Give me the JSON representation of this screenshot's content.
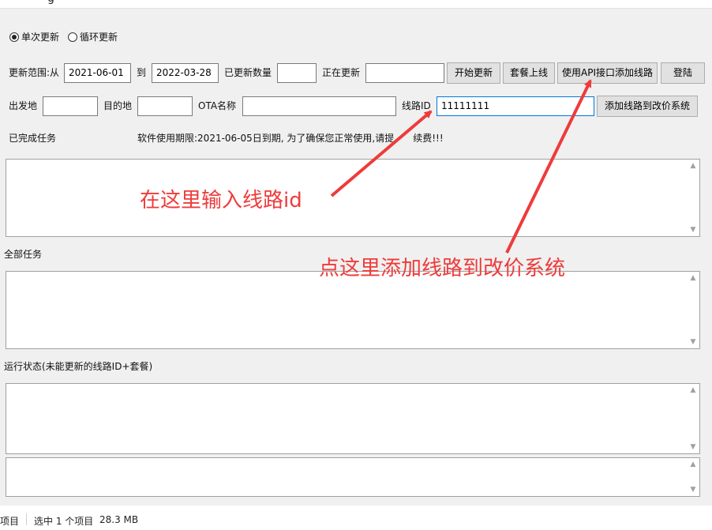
{
  "window": {
    "title_fragment": "g"
  },
  "update_mode": {
    "options": [
      {
        "label": "单次更新",
        "checked": true
      },
      {
        "label": "循环更新",
        "checked": false
      }
    ]
  },
  "row1": {
    "range_label": "更新范围:从",
    "date_from": "2021-06-01",
    "to_label": "到",
    "date_to": "2022-03-28",
    "updated_count_label": "已更新数量",
    "updated_count_value": "",
    "updating_label": "正在更新",
    "updating_value": "",
    "start_button": "开始更新",
    "package_online_button": "套餐上线",
    "api_add_route_button": "使用API接口添加线路",
    "login_button": "登陆"
  },
  "row2": {
    "departure_label": "出发地",
    "departure_value": "",
    "destination_label": "目的地",
    "destination_value": "",
    "ota_label": "OTA名称",
    "ota_value": "",
    "route_id_label": "线路ID",
    "route_id_value": "11111111",
    "add_route_button": "添加线路到改价系统"
  },
  "notices": {
    "completed_label": "已完成任务",
    "expiry_before": "软件使用期限:2021-06-05日到期,   为了确保您正常使用,请提",
    "expiry_after": "续费!!!"
  },
  "sections": {
    "all_tasks_label": "全部任务",
    "run_status_label": "运行状态(未能更新的线路ID+套餐)"
  },
  "annotations": {
    "input_route_id": "在这里输入线路id",
    "add_route_here": "点这里添加线路到改价系统",
    "color": "#ef3b3b"
  },
  "statusbar": {
    "items_fragment": "项目",
    "selected": "选中 1 个项目",
    "size": "28.3 MB"
  }
}
